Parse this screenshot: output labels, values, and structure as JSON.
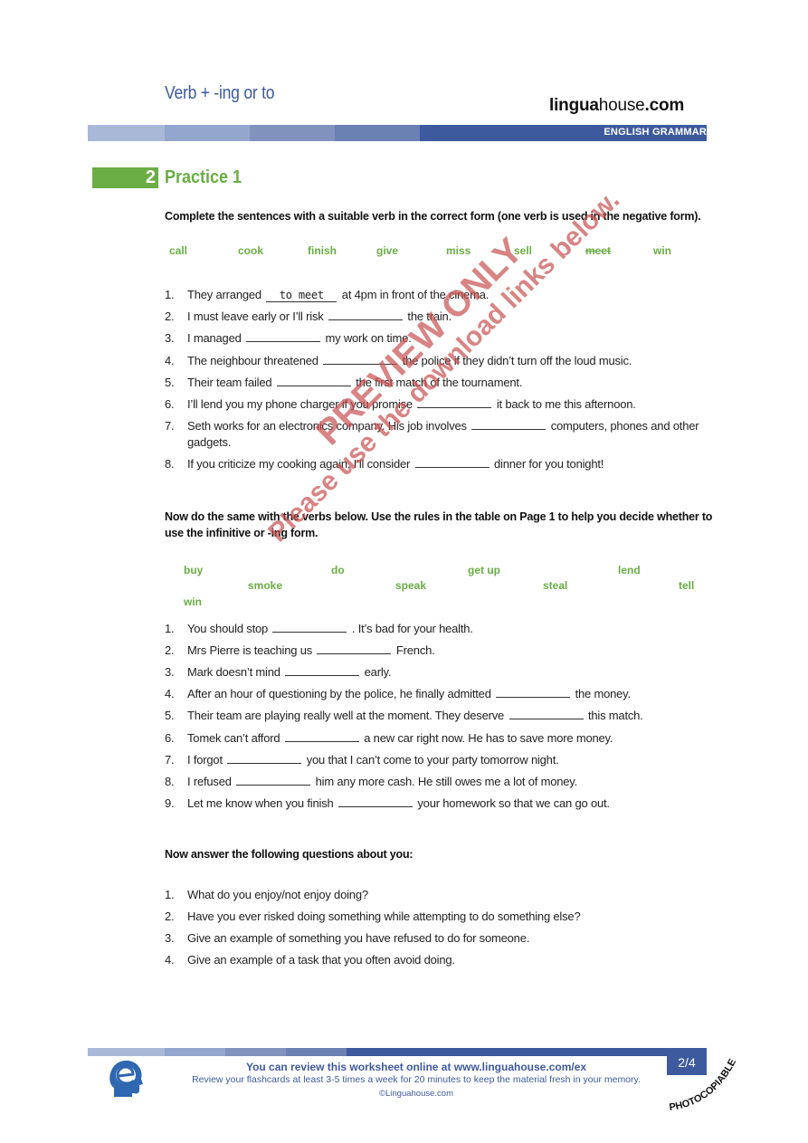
{
  "header": {
    "title": "Verb + -ing or to",
    "brand_bold": "lingua",
    "brand_regular": "house",
    "brand_tld": ".com",
    "category": "ENGLISH GRAMMAR",
    "bar_colors": [
      "#aab8d8",
      "#93a6cc",
      "#7f93bd",
      "#6b80b3",
      "#3d5a9e"
    ]
  },
  "section": {
    "number": "2",
    "title": "Practice 1",
    "accent_color": "#6aad45"
  },
  "part1": {
    "instruction": "Complete the sentences with a suitable verb in the correct form (one verb is used in the negative form).",
    "verbs": [
      {
        "text": "call",
        "struck": false
      },
      {
        "text": "cook",
        "struck": false
      },
      {
        "text": "finish",
        "struck": false
      },
      {
        "text": "give",
        "struck": false
      },
      {
        "text": "miss",
        "struck": false
      },
      {
        "text": "sell",
        "struck": false
      },
      {
        "text": "meet",
        "struck": true
      },
      {
        "text": "win",
        "struck": false
      }
    ],
    "items": [
      {
        "num": "1.",
        "before": "They arranged",
        "answer": "to meet",
        "after": "at 4pm in front of the cinema."
      },
      {
        "num": "2.",
        "before": "I must leave early or I’ll risk",
        "answer": "",
        "after": "the train."
      },
      {
        "num": "3.",
        "before": "I managed",
        "answer": "",
        "after": "my work on time."
      },
      {
        "num": "4.",
        "before": "The neighbour threatened",
        "answer": "",
        "after": "the police if they didn’t turn off the loud music."
      },
      {
        "num": "5.",
        "before": "Their team failed",
        "answer": "",
        "after": "the first match of the tournament."
      },
      {
        "num": "6.",
        "before": "I’ll lend you my phone charger if you promise",
        "answer": "",
        "after": "it back to me this afternoon."
      },
      {
        "num": "7.",
        "before": "Seth works for an electronics company. His job involves",
        "answer": "",
        "after": "computers, phones and other gadgets."
      },
      {
        "num": "8.",
        "before": "If you criticize my cooking again, I’ll consider",
        "answer": "",
        "after": "dinner for you tonight!"
      }
    ]
  },
  "part2": {
    "instruction": "Now do the same with the verbs below. Use the rules in the table on Page 1 to help you decide whether to use the infinitive or -ing form.",
    "verbs": [
      "buy",
      "do",
      "get up",
      "lend",
      "smoke",
      "speak",
      "steal",
      "tell",
      "win"
    ],
    "items": [
      {
        "num": "1.",
        "before": "You should stop",
        "after": ". It’s bad for your health."
      },
      {
        "num": "2.",
        "before": "Mrs Pierre is teaching us",
        "after": "French."
      },
      {
        "num": "3.",
        "before": "Mark doesn’t mind",
        "after": "early."
      },
      {
        "num": "4.",
        "before": "After an hour of questioning by the police, he finally admitted",
        "after": "the money."
      },
      {
        "num": "5.",
        "before": "Their team are playing really well at the moment. They deserve",
        "after": "this match."
      },
      {
        "num": "6.",
        "before": "Tomek can’t afford",
        "after": "a new car right now. He has to save more money."
      },
      {
        "num": "7.",
        "before": "I forgot",
        "after": "you that I can’t come to your party tomorrow night."
      },
      {
        "num": "8.",
        "before": "I refused",
        "after": "him any more cash. He still owes me a lot of money."
      },
      {
        "num": "9.",
        "before": "Let me know when you finish",
        "after": "your homework so that we can go out."
      }
    ]
  },
  "part3": {
    "instruction": "Now answer the following questions about you:",
    "items": [
      {
        "num": "1.",
        "text": "What do you enjoy/not enjoy doing?"
      },
      {
        "num": "2.",
        "text": "Have you ever risked doing something while attempting to do something else?"
      },
      {
        "num": "3.",
        "text": "Give an example of something you have refused to do for someone."
      },
      {
        "num": "4.",
        "text": "Give an example of a task that you often avoid doing."
      }
    ]
  },
  "watermark": {
    "line1": "PREVIEW ONLY",
    "line2": "Please use the download links below."
  },
  "footer": {
    "line1": "You can review this worksheet online at www.linguahouse.com/ex",
    "line2": "Review your flashcards at least 3-5 times a week for 20 minutes to keep the material fresh in your memory.",
    "line3": "©Linguahouse.com",
    "page": "2/4",
    "stamp": "PHOTOCOPIABLE"
  }
}
